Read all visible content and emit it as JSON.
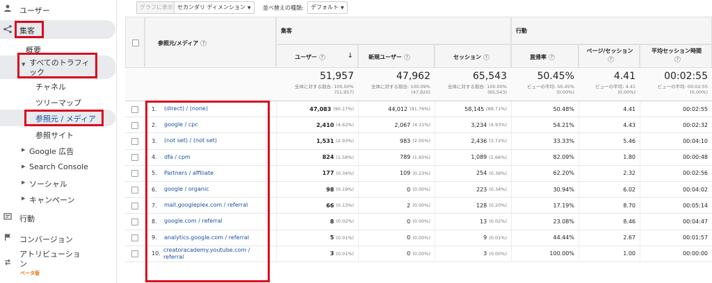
{
  "sidebar": {
    "users": "ユーザー",
    "acquisition": "集客",
    "overview": "概要",
    "all_traffic": "すべてのトラフィック",
    "channels": "チャネル",
    "treemaps": "ツリーマップ",
    "source_medium": "参照元 / メディア",
    "referrals": "参照サイト",
    "google_ads": "Google 広告",
    "search_console": "Search Console",
    "social": "ソーシャル",
    "campaigns": "キャンペーン",
    "behavior": "行動",
    "conversions": "コンバージョン",
    "attribution": "アトリビューション",
    "beta": "ベータ版",
    "accent": "#d8091d"
  },
  "toolbar": {
    "plot_rows": "グラフに表示",
    "secondary_dimension": "セカンダリ ディメンション",
    "sort_type_label": "並べ替えの種類:",
    "sort_type_value": "デフォルト"
  },
  "table": {
    "dimension_header": "参照元/メディア",
    "group_acquisition": "集客",
    "group_behavior": "行動",
    "columns": [
      "ユーザー",
      "新規ユーザー",
      "セッション",
      "直帰率",
      "ページ/セッション",
      "平均セッション時間"
    ],
    "totals": [
      {
        "value": "51,957",
        "sub1": "全体に対する割合: 100.00%",
        "sub2": "(51,957)"
      },
      {
        "value": "47,962",
        "sub1": "全体に対する割合: 100.09%",
        "sub2": "(47,920)"
      },
      {
        "value": "65,543",
        "sub1": "全体に対する割合: 100.00%",
        "sub2": "(65,543)"
      },
      {
        "value": "50.45%",
        "sub1": "ビューの平均: 50.45%",
        "sub2": "(0.00%)"
      },
      {
        "value": "4.41",
        "sub1": "ビューの平均: 4.41",
        "sub2": "(0.00%)"
      },
      {
        "value": "00:02:55",
        "sub1": "ビューの平均: 00:02:55",
        "sub2": "(0.00%)"
      }
    ],
    "rows": [
      {
        "idx": "1.",
        "source": "(direct) / (none)",
        "users": "47,083",
        "users_pct": "(90.17%)",
        "new_users": "44,012",
        "new_users_pct": "(91.76%)",
        "sessions": "58,145",
        "sessions_pct": "(88.71%)",
        "bounce": "50.48%",
        "pages": "4.41",
        "duration": "00:02:55"
      },
      {
        "idx": "2.",
        "source": "google / cpc",
        "users": "2,410",
        "users_pct": "(4.62%)",
        "new_users": "2,067",
        "new_users_pct": "(4.31%)",
        "sessions": "3,234",
        "sessions_pct": "(4.93%)",
        "bounce": "54.21%",
        "pages": "4.43",
        "duration": "00:02:32"
      },
      {
        "idx": "3.",
        "source": "(not set) / (not set)",
        "users": "1,531",
        "users_pct": "(2.93%)",
        "new_users": "983",
        "new_users_pct": "(2.05%)",
        "sessions": "2,436",
        "sessions_pct": "(3.72%)",
        "bounce": "33.33%",
        "pages": "5.46",
        "duration": "00:04:10"
      },
      {
        "idx": "4.",
        "source": "dfa / cpm",
        "users": "824",
        "users_pct": "(1.58%)",
        "new_users": "789",
        "new_users_pct": "(1.65%)",
        "sessions": "1,089",
        "sessions_pct": "(1.66%)",
        "bounce": "82.09%",
        "pages": "1.80",
        "duration": "00:00:48"
      },
      {
        "idx": "5.",
        "source": "Partners / affiliate",
        "users": "177",
        "users_pct": "(0.34%)",
        "new_users": "109",
        "new_users_pct": "(0.23%)",
        "sessions": "254",
        "sessions_pct": "(0.39%)",
        "bounce": "62.20%",
        "pages": "2.32",
        "duration": "00:02:56"
      },
      {
        "idx": "6.",
        "source": "google / organic",
        "users": "98",
        "users_pct": "(0.19%)",
        "new_users": "0",
        "new_users_pct": "(0.00%)",
        "sessions": "223",
        "sessions_pct": "(0.34%)",
        "bounce": "30.94%",
        "pages": "6.02",
        "duration": "00:04:02"
      },
      {
        "idx": "7.",
        "source": "mall.googleplex.com / referral",
        "users": "66",
        "users_pct": "(0.13%)",
        "new_users": "2",
        "new_users_pct": "(0.00%)",
        "sessions": "128",
        "sessions_pct": "(0.20%)",
        "bounce": "17.19%",
        "pages": "8.70",
        "duration": "00:05:14"
      },
      {
        "idx": "8.",
        "source": "google.com / referral",
        "users": "8",
        "users_pct": "(0.02%)",
        "new_users": "0",
        "new_users_pct": "(0.00%)",
        "sessions": "13",
        "sessions_pct": "(0.02%)",
        "bounce": "23.08%",
        "pages": "8.46",
        "duration": "00:04:47"
      },
      {
        "idx": "9.",
        "source": "analytics.google.com / referral",
        "users": "5",
        "users_pct": "(0.01%)",
        "new_users": "0",
        "new_users_pct": "(0.00%)",
        "sessions": "9",
        "sessions_pct": "(0.01%)",
        "bounce": "44.44%",
        "pages": "2.67",
        "duration": "00:01:57"
      },
      {
        "idx": "10.",
        "source": "creatoracademy.youtube.com / referral",
        "users": "3",
        "users_pct": "(0.01%)",
        "new_users": "0",
        "new_users_pct": "(0.00%)",
        "sessions": "3",
        "sessions_pct": "(0.00%)",
        "bounce": "100.00%",
        "pages": "1.00",
        "duration": "00:00:00"
      }
    ]
  }
}
